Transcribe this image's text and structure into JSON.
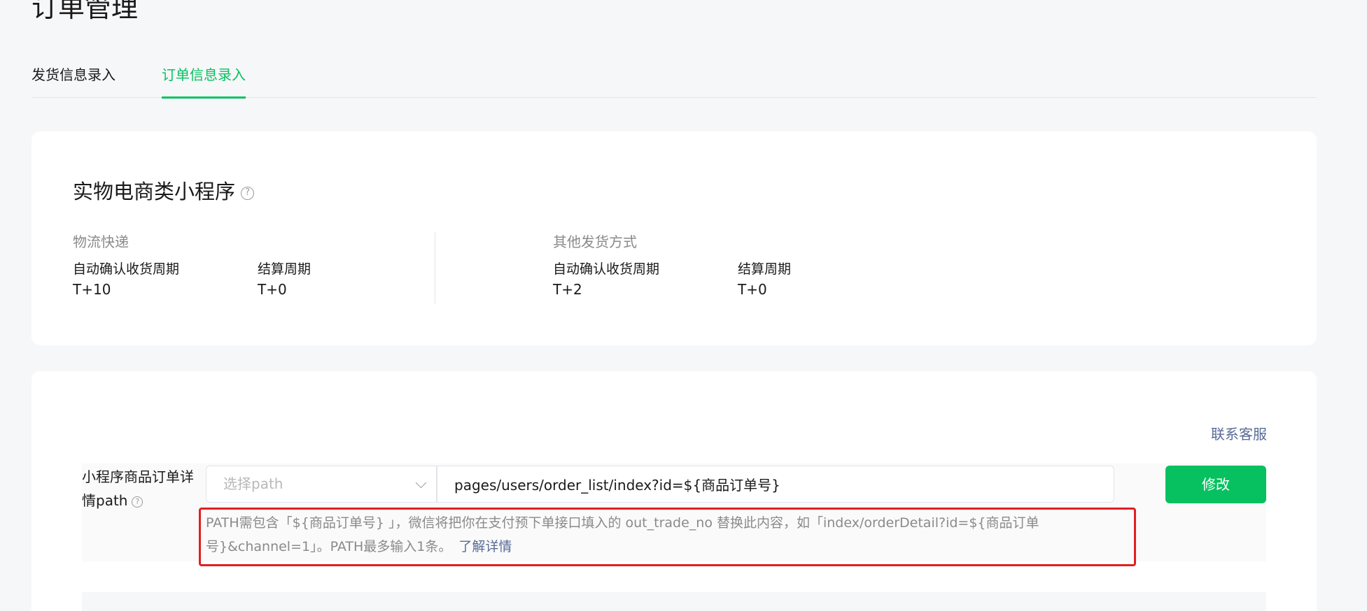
{
  "page": {
    "title": "订单管理"
  },
  "tabs": [
    {
      "label": "发货信息录入",
      "active": false
    },
    {
      "label": "订单信息录入",
      "active": true
    }
  ],
  "colors": {
    "accent": "#07c160",
    "link": "#576b95",
    "highlight_border": "#e02020"
  },
  "mini_program": {
    "title": "实物电商类小程序",
    "help_icon": "question-circle-icon",
    "shipping_methods": [
      {
        "name": "物流快递",
        "auto_confirm_label": "自动确认收货周期",
        "auto_confirm_value": "T+10",
        "settlement_label": "结算周期",
        "settlement_value": "T+0"
      },
      {
        "name": "其他发货方式",
        "auto_confirm_label": "自动确认收货周期",
        "auto_confirm_value": "T+2",
        "settlement_label": "结算周期",
        "settlement_value": "T+0"
      }
    ]
  },
  "order_path": {
    "contact_link": "联系客服",
    "field_label": "小程序商品订单详情path",
    "select_placeholder": "选择path",
    "path_value": "pages/users/order_list/index?id=${商品订单号}",
    "modify_button": "修改",
    "hint_text": "PATH需包含「${商品订单号} 」，微信将把你在支付预下单接口填入的 out_trade_no 替换此内容，如「index/orderDetail?id=${商品订单号}&channel=1」。PATH最多输入1条。",
    "hint_link": "了解详情"
  }
}
